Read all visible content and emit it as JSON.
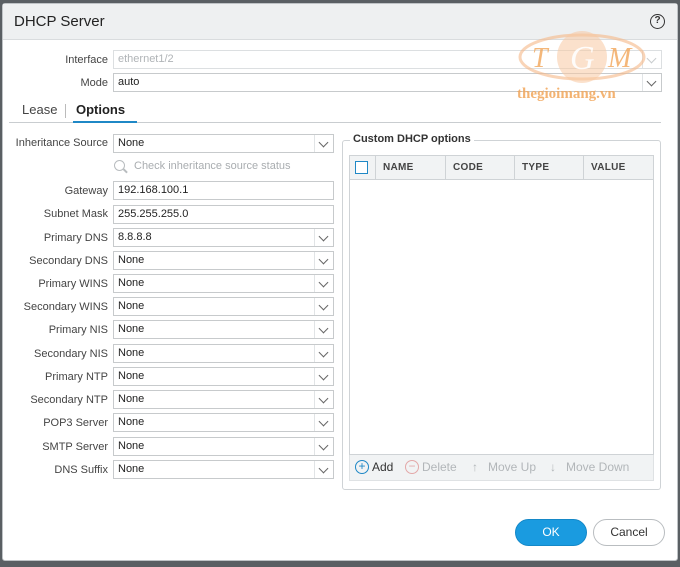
{
  "dialog": {
    "title": "DHCP Server",
    "help_glyph": "?"
  },
  "top_fields": {
    "interface": {
      "label": "Interface",
      "value": "ethernet1/2"
    },
    "mode": {
      "label": "Mode",
      "value": "auto"
    }
  },
  "tabs": [
    {
      "label": "Lease"
    },
    {
      "label": "Options"
    }
  ],
  "options": {
    "inheritance_source": {
      "label": "Inheritance Source",
      "value": "None"
    },
    "check_status_label": "Check inheritance source status",
    "gateway": {
      "label": "Gateway",
      "value": "192.168.100.1"
    },
    "subnet_mask": {
      "label": "Subnet Mask",
      "value": "255.255.255.0"
    },
    "primary_dns": {
      "label": "Primary DNS",
      "value": "8.8.8.8"
    },
    "secondary_dns": {
      "label": "Secondary DNS",
      "value": "None"
    },
    "primary_wins": {
      "label": "Primary WINS",
      "value": "None"
    },
    "secondary_wins": {
      "label": "Secondary WINS",
      "value": "None"
    },
    "primary_nis": {
      "label": "Primary NIS",
      "value": "None"
    },
    "secondary_nis": {
      "label": "Secondary NIS",
      "value": "None"
    },
    "primary_ntp": {
      "label": "Primary NTP",
      "value": "None"
    },
    "secondary_ntp": {
      "label": "Secondary NTP",
      "value": "None"
    },
    "pop3_server": {
      "label": "POP3 Server",
      "value": "None"
    },
    "smtp_server": {
      "label": "SMTP Server",
      "value": "None"
    },
    "dns_suffix": {
      "label": "DNS Suffix",
      "value": "None"
    }
  },
  "custom_options": {
    "legend": "Custom DHCP options",
    "columns": [
      "NAME",
      "CODE",
      "TYPE",
      "VALUE"
    ],
    "rows": [],
    "actions": {
      "add": "Add",
      "delete": "Delete",
      "move_up": "Move Up",
      "move_down": "Move Down"
    }
  },
  "footer": {
    "ok": "OK",
    "cancel": "Cancel"
  },
  "watermark": {
    "logo_letters": "TGM",
    "site": "thegioimang.vn"
  },
  "colors": {
    "accent": "#1f88c6",
    "ok_button": "#1a9be0",
    "watermark": "#f2a65a"
  }
}
